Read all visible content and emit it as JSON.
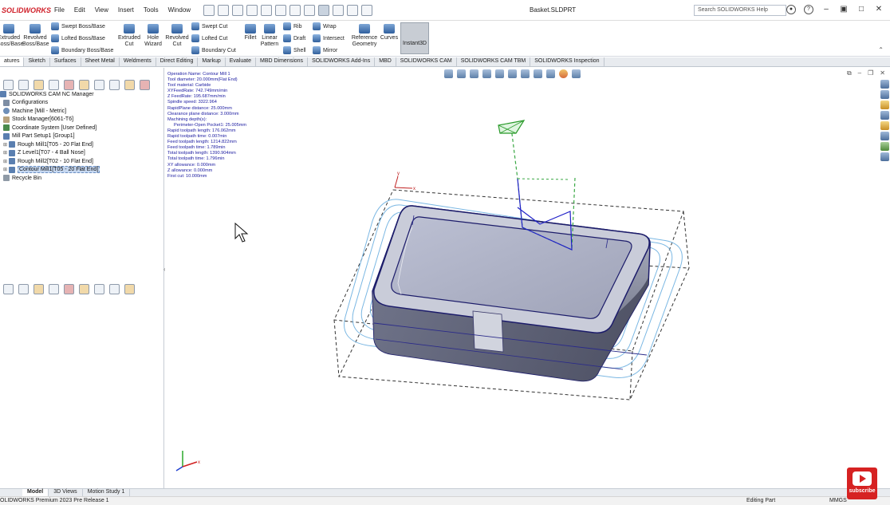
{
  "app": {
    "logo_text": "SOLIDWORKS",
    "document_title": "Basket.SLDPRT",
    "accent_color": "#d0202a"
  },
  "menu": [
    "File",
    "Edit",
    "View",
    "Insert",
    "Tools",
    "Window"
  ],
  "search": {
    "placeholder": "Search SOLIDWORKS Help"
  },
  "ribbon": {
    "extruded_boss": "Extruded Boss/Base",
    "revolved_boss": "Revolved Boss/Base",
    "swept_boss": "Swept Boss/Base",
    "lofted_boss": "Lofted Boss/Base",
    "boundary_boss": "Boundary Boss/Base",
    "extruded_cut": "Extruded Cut",
    "hole_wizard": "Hole Wizard",
    "revolved_cut": "Revolved Cut",
    "swept_cut": "Swept Cut",
    "lofted_cut": "Lofted Cut",
    "boundary_cut": "Boundary Cut",
    "fillet": "Fillet",
    "linear_pattern": "Linear Pattern",
    "rib": "Rib",
    "draft": "Draft",
    "shell": "Shell",
    "wrap": "Wrap",
    "intersect": "Intersect",
    "mirror": "Mirror",
    "reference_geometry": "Reference Geometry",
    "curves": "Curves",
    "instant3d": "Instant3D"
  },
  "tabs": [
    "atures",
    "Sketch",
    "Surfaces",
    "Sheet Metal",
    "Weldments",
    "Direct Editing",
    "Markup",
    "Evaluate",
    "MBD Dimensions",
    "SOLIDWORKS Add-Ins",
    "MBD",
    "SOLIDWORKS CAM",
    "SOLIDWORKS CAM TBM",
    "SOLIDWORKS Inspection"
  ],
  "tree": {
    "root": "SOLIDWORKS CAM NC Manager",
    "items": [
      {
        "label": "Configurations",
        "icon": "config-icon",
        "expand": ""
      },
      {
        "label": "Machine [Mill - Metric]",
        "icon": "machine-icon",
        "expand": ""
      },
      {
        "label": "Stock Manager[6061-T6]",
        "icon": "stock-icon",
        "expand": ""
      },
      {
        "label": "Coordinate System [User Defined]",
        "icon": "coordinate-icon",
        "expand": ""
      },
      {
        "label": "Mill Part Setup1 [Group1]",
        "icon": "setup-icon",
        "expand": ""
      },
      {
        "label": "Rough Mill1[T05 - 20 Flat End]",
        "icon": "operation-icon",
        "expand": "⊞"
      },
      {
        "label": "Z Level1[T07 - 4 Ball Nose]",
        "icon": "operation-icon",
        "expand": "⊞"
      },
      {
        "label": "Rough Mill2[T02 - 10 Flat End]",
        "icon": "operation-icon",
        "expand": "⊞"
      },
      {
        "label": "Contour Mill1[T05 - 20 Flat End]",
        "icon": "operation-icon",
        "expand": "⊞"
      },
      {
        "label": "Recycle Bin",
        "icon": "recycle-bin-icon",
        "expand": ""
      }
    ]
  },
  "operation_info": {
    "lines": [
      "Operation Name: Contour Mill 1",
      "Tool diameter: 20.000mm(Flat End)",
      "Tool material: Carbide",
      "XYFeedRate: 742.749mm/min",
      "Z FeedRate: 195.687mm/min",
      "Spindle speed: 3322.964",
      "RapidPlane distance: 25.000mm",
      "Clearance plane distance: 3.000mm",
      "Machining depth(s):"
    ],
    "depth_line": "Perimeter-Open Pocket1: 25.005mm",
    "lines2": [
      "Rapid toolpath length: 176.062mm",
      "Rapid toolpath time: 0.007min",
      "Feed toolpath length: 1214.822mm",
      "Feed toolpath time: 1.789min",
      "Total toolpath length: 1390.904mm",
      "Total toolpath time: 1.796min",
      "XY allowance: 0.000mm",
      "Z allowance: 0.000mm",
      "First cut: 10.000mm"
    ]
  },
  "bottom_tabs": [
    "Model",
    "3D Views",
    "Motion Study 1"
  ],
  "status": {
    "left": "OLIDWORKS Premium 2023 Pre Release 1",
    "mode": "Editing Part",
    "units": "MMGS"
  },
  "overlay": {
    "subscribe": "subscribe"
  }
}
